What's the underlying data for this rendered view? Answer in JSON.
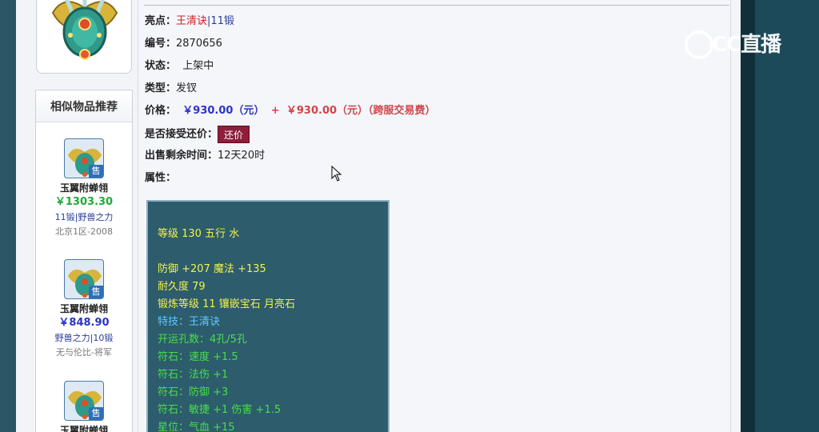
{
  "item": {
    "highlight_label": "亮点：",
    "highlight_skill": "王清诀",
    "highlight_sep": "|",
    "highlight_forge": "11锻",
    "id_label": "编号：",
    "id_value": "2870656",
    "status_label": "状态：",
    "status_value": "上架中",
    "type_label": "类型：",
    "type_value": "发钗",
    "price_label": "价格：",
    "price_value": "￥930.00（元）",
    "price_plus": "+",
    "price_fee": "￥930.00（元）（跨服交易费）",
    "counter_label": "是否接受还价：",
    "counter_button": "还价",
    "time_label": "出售剩余时间：",
    "time_value": "12天20时",
    "attr_label": "属性："
  },
  "attributes": {
    "level_line": "等级 130 五行 水",
    "defense_line": "防御 +207 魔法 +135",
    "durability_line": "耐久度 79",
    "forge_line": "锻炼等级 11 镶嵌宝石 月亮石",
    "skill_line": "特技：王清诀",
    "holes_line": "开运孔数：4孔/5孔",
    "rune1": "符石：速度 +1.5",
    "rune2": "符石：法伤 +1",
    "rune3": "符石：防御 +3",
    "rune4": "符石：敏捷 +1 伤害 +1.5",
    "star_line": "星位：气血 +15"
  },
  "sidebar": {
    "title": "相似物品推荐",
    "sell_badge": "售",
    "items": [
      {
        "name": "玉翼附蝉翎",
        "price": "￥1303.30",
        "price_color": "#22a83a",
        "tags": "11锻|野兽之力",
        "server": "北京1区-2008"
      },
      {
        "name": "玉翼附蝉翎",
        "price": "￥848.90",
        "price_color": "#2b33c6",
        "tags": "野兽之力|10锻",
        "server": "无与伦比-将军"
      },
      {
        "name": "玉翼附蝉翎",
        "price": "",
        "price_color": "#22a83a",
        "tags": "",
        "server": ""
      }
    ]
  },
  "watermark": {
    "text": "CC直播"
  },
  "colors": {
    "attr_bg": "#2d5c6c",
    "yellow_text": "#f2f24a",
    "green_text": "#45e04a",
    "skill_text": "#5fc8ff",
    "counter_button_bg": "#8e1e3a"
  }
}
